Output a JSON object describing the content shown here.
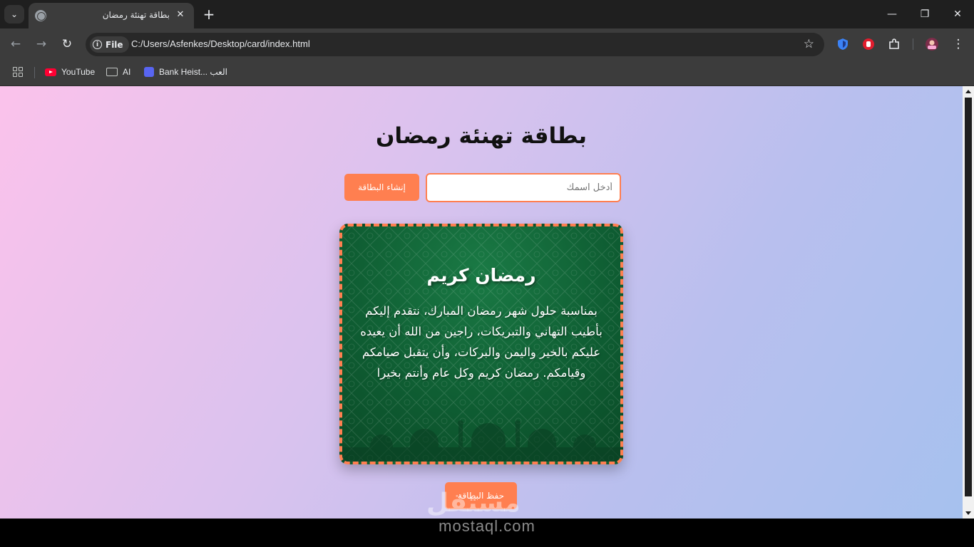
{
  "browser": {
    "tab_title": "بطاقة تهنئة رمضان",
    "url_scheme_label": "File",
    "url": "C:/Users/Asfenkes/Desktop/card/index.html",
    "bookmarks": [
      {
        "label": "YouTube",
        "icon": "youtube-icon"
      },
      {
        "label": "AI",
        "icon": "folder-icon"
      },
      {
        "label": "Bank Heist... العب",
        "icon": "bank-heist-icon"
      }
    ]
  },
  "page": {
    "title": "بطاقة تهنئة رمضان",
    "name_placeholder": "أدخل اسمك",
    "create_button": "إنشاء البطاقة",
    "save_button": "حفظ البطاقة"
  },
  "card": {
    "title": "رمضان كريم",
    "text": "بمناسبة حلول شهر رمضان المبارك، نتقدم إليكم بأطيب التهاني والتبريكات، راجين من الله أن يعيده عليكم بالخير واليمن والبركات، وأن يتقبل صيامكم وقيامكم. رمضان كريم وكل عام وأنتم بخيرا"
  },
  "watermark": {
    "arabic": "مستقل",
    "latin": "mostaql.com"
  },
  "colors": {
    "accent": "#ff7f50",
    "card_green": "#0f5e33"
  }
}
